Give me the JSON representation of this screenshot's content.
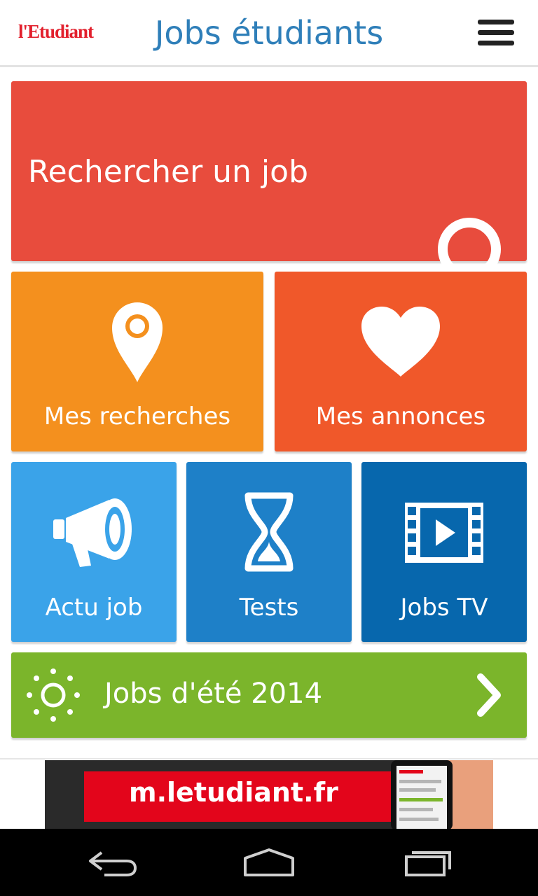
{
  "header": {
    "logo": "l'Etudiant",
    "title": "Jobs étudiants"
  },
  "tiles": {
    "search": {
      "label": "Rechercher un job",
      "color": "#e84c3d",
      "icon": "search-icon"
    },
    "recherches": {
      "label": "Mes recherches",
      "color": "#f4901e",
      "icon": "map-pin-icon"
    },
    "annonces": {
      "label": "Mes annonces",
      "color": "#f0582a",
      "icon": "heart-icon"
    },
    "actu": {
      "label": "Actu job",
      "color": "#3aa3e9",
      "icon": "megaphone-icon"
    },
    "tests": {
      "label": "Tests",
      "color": "#1e80c8",
      "icon": "hourglass-icon"
    },
    "tv": {
      "label": "Jobs TV",
      "color": "#0767ad",
      "icon": "film-icon"
    },
    "ete": {
      "label": "Jobs d'été 2014",
      "color": "#7bb52b",
      "icon": "sun-icon",
      "arrow": "chevron-right-icon"
    }
  },
  "banner": {
    "text": "m.letudiant.fr"
  },
  "navbar": {
    "icons": [
      "back-icon",
      "home-icon",
      "recents-icon"
    ]
  }
}
